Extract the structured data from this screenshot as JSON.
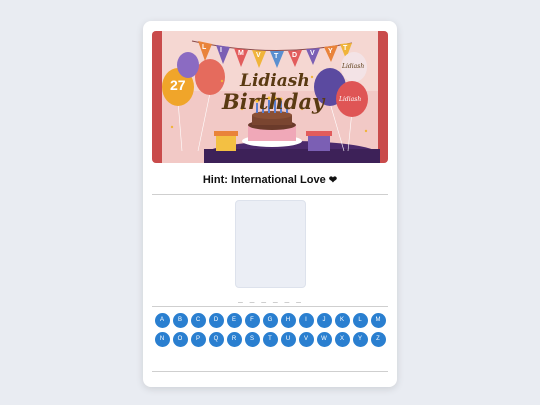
{
  "banner": {
    "title_line1": "Lidiash",
    "title_line2": "Birthday",
    "age": "27",
    "balloon_name_1": "Lidiash",
    "balloon_name_2": "Lidiash",
    "bunting": [
      "L",
      "I",
      "M",
      "V",
      "T",
      "D",
      "V",
      "Y",
      "T"
    ]
  },
  "hint": {
    "text": "Hint: International Love",
    "icon": "heart-icon"
  },
  "answer": {
    "blanks": "_ _ _ _ _ _"
  },
  "keyboard": {
    "letters": [
      "A",
      "B",
      "C",
      "D",
      "E",
      "F",
      "G",
      "H",
      "I",
      "J",
      "K",
      "L",
      "M",
      "N",
      "O",
      "P",
      "Q",
      "R",
      "S",
      "T",
      "U",
      "V",
      "W",
      "X",
      "Y",
      "Z"
    ]
  },
  "colors": {
    "key_bg": "#2a7fd0",
    "page_bg": "#e9ecf2",
    "card_bg": "#ffffff"
  }
}
